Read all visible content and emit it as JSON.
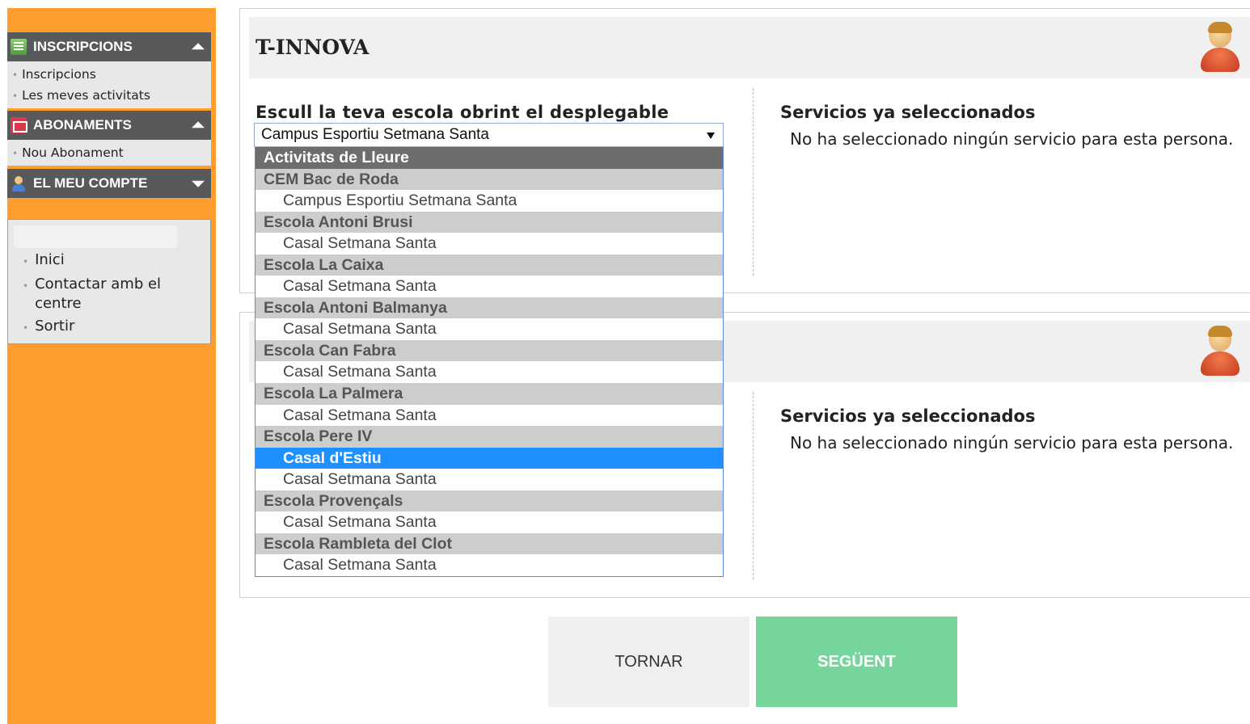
{
  "sidebar": {
    "sections": [
      {
        "title": "INSCRIPCIONS",
        "items": [
          "Inscripcions",
          "Les meves activitats"
        ]
      },
      {
        "title": "ABONAMENTS",
        "items": [
          "Nou Abonament"
        ]
      },
      {
        "title": "EL MEU COMPTE",
        "items": []
      }
    ],
    "links": [
      "Inici",
      "Contactar amb el centre",
      "Sortir"
    ]
  },
  "cards": [
    {
      "title": "T-INNOVA",
      "select_label": "Escull la teva escola obrint el desplegable",
      "services_title": "Servicios ya seleccionados",
      "services_text": "No ha seleccionado ningún servicio para esta persona."
    },
    {
      "title": "",
      "services_title": "Servicios ya seleccionados",
      "services_text": "No ha seleccionado ningún servicio para esta persona."
    }
  ],
  "select": {
    "value": "Campus Esportiu Setmana Santa",
    "options": [
      {
        "group": "Activitats de Lleure",
        "items": []
      },
      {
        "group": "CEM Bac de Roda",
        "items": [
          "Campus Esportiu Setmana Santa"
        ]
      },
      {
        "group": "Escola Antoni Brusi",
        "items": [
          "Casal Setmana Santa"
        ]
      },
      {
        "group": "Escola La Caixa",
        "items": [
          "Casal Setmana Santa"
        ]
      },
      {
        "group": "Escola Antoni Balmanya",
        "items": [
          "Casal Setmana Santa"
        ]
      },
      {
        "group": "Escola Can Fabra",
        "items": [
          "Casal Setmana Santa"
        ]
      },
      {
        "group": "Escola La Palmera",
        "items": [
          "Casal Setmana Santa"
        ]
      },
      {
        "group": "Escola Pere IV",
        "items": [
          "Casal d'Estiu",
          "Casal Setmana Santa"
        ]
      },
      {
        "group": "Escola Provençals",
        "items": [
          "Casal Setmana Santa"
        ]
      },
      {
        "group": "Escola Rambleta del Clot",
        "items": [
          "Casal Setmana Santa"
        ]
      }
    ],
    "highlighted": "Casal d'Estiu"
  },
  "buttons": {
    "back": "TORNAR",
    "next": "SEGÜENT"
  },
  "colors": {
    "sidebar": "#ff9d2e",
    "menu_header": "#58595b",
    "next_button": "#76d59a",
    "highlight": "#1e90ff"
  }
}
